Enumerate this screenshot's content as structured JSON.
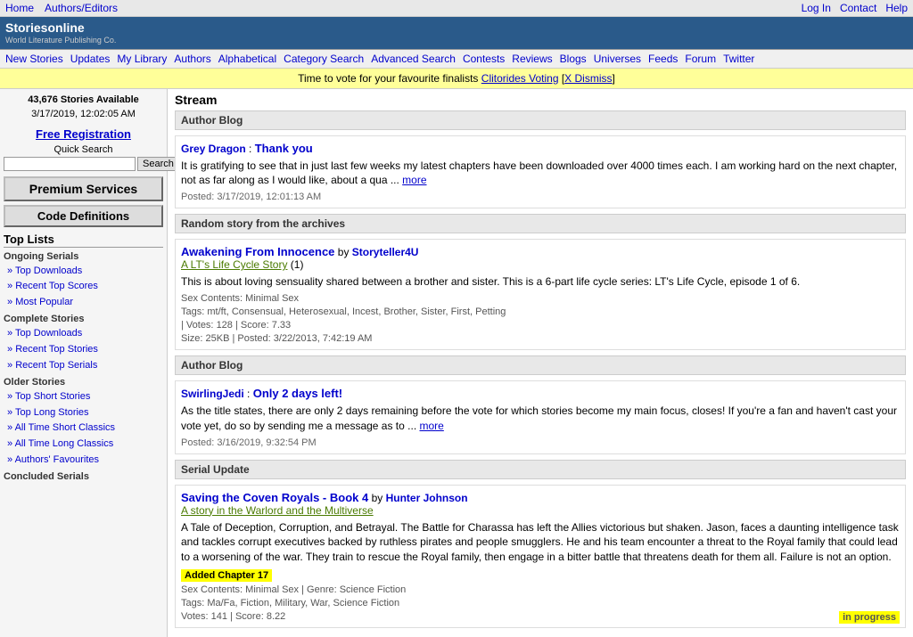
{
  "topnav": {
    "links": [
      "Home",
      "Authors/Editors"
    ],
    "right_links": [
      "Log In",
      "Contact",
      "Help"
    ]
  },
  "logo": {
    "title": "Storiesonline",
    "sub": "World Literature Publishing Co."
  },
  "mainnav": {
    "links": [
      "New Stories",
      "Updates",
      "My Library",
      "Authors",
      "Alphabetical",
      "Category Search",
      "Advanced Search",
      "Contests",
      "Reviews",
      "Blogs",
      "Universes",
      "Feeds",
      "Forum",
      "Twitter"
    ]
  },
  "banner": {
    "text": "Time to vote for your favourite finalists",
    "link_text": "Clitorides Voting",
    "dismiss_text": "X Dismiss"
  },
  "sidebar": {
    "stats_count": "43,676 Stories Available",
    "stats_date": "3/17/2019, 12:02:05 AM",
    "free_reg": "Free Registration",
    "quick_search": "Quick Search",
    "search_placeholder": "",
    "search_btn": "Search",
    "premium_btn": "Premium Services",
    "code_def_btn": "Code Definitions",
    "top_lists": "Top Lists",
    "ongoing_serials": "Ongoing Serials",
    "ongoing_links": [
      "Top Downloads",
      "Recent Top Scores",
      "Most Popular"
    ],
    "complete_stories": "Complete Stories",
    "complete_links": [
      "Top Downloads",
      "Recent Top Stories",
      "Recent Top Serials"
    ],
    "older_stories": "Older Stories",
    "older_links": [
      "Top Short Stories",
      "Top Long Stories",
      "All Time Short Classics",
      "All Time Long Classics",
      "Authors' Favourites"
    ],
    "concluded": "Concluded Serials"
  },
  "main": {
    "stream_title": "Stream",
    "sections": [
      {
        "type": "Author Blog",
        "entries": [
          {
            "author": "Grey Dragon",
            "title": "Thank you",
            "body": "It is gratifying to see that in just last few weeks my latest chapters have been downloaded over 4000 times each. I am working hard on the next chapter, not as far along as I would like, about a qua ...",
            "more": "more",
            "posted": "Posted: 3/17/2019, 12:01:13 AM"
          }
        ]
      },
      {
        "type": "Random story from the archives",
        "entries": [
          {
            "title": "Awakening From Innocence",
            "author": "Storyteller4U",
            "subtitle": "A LT's Life Cycle Story",
            "subtitle_num": "(1)",
            "desc": "This is about loving sensuality shared between a brother and sister. This is a 6-part life cycle series: LT's Life Cycle, episode 1 of 6.",
            "sex_contents": "Sex Contents: Minimal Sex",
            "tags": "Tags: mt/ft, Consensual, Heterosexual, Incest, Brother, Sister, First, Petting",
            "votes": "128",
            "score": "7.33",
            "size": "25KB",
            "posted": "3/22/2013, 7:42:19 AM"
          }
        ]
      },
      {
        "type": "Author Blog",
        "entries": [
          {
            "author": "SwirlingJedi",
            "title": "Only 2 days left!",
            "body": "As the title states, there are only 2 days remaining before the vote for which stories become my main focus, closes! If you're a fan and haven't cast your vote yet, do so by sending me a message as to ...",
            "more": "more",
            "posted": "Posted: 3/16/2019, 9:32:54 PM"
          }
        ]
      },
      {
        "type": "Serial Update",
        "entries": [
          {
            "title": "Saving the Coven Royals - Book 4",
            "author": "Hunter Johnson",
            "subtitle": "A story in the Warlord and the Multiverse",
            "desc": "A Tale of Deception, Corruption, and Betrayal. The Battle for Charassa has left the Allies victorious but shaken. Jason, faces a daunting intelligence task and tackles corrupt executives backed by ruthless pirates and people smugglers. He and his team encounter a threat to the Royal family that could lead to a worsening of the war. They train to rescue the Royal family, then engage in a bitter battle that threatens death for them all. Failure is not an option.",
            "added_badge": "Added Chapter 17",
            "sex_contents": "Sex Contents: Minimal Sex | Genre: Science Fiction",
            "tags": "Tags: Ma/Fa, Fiction, Military, War, Science Fiction",
            "votes": "141",
            "score": "8.22",
            "status_badge": "in progress"
          }
        ]
      }
    ]
  }
}
